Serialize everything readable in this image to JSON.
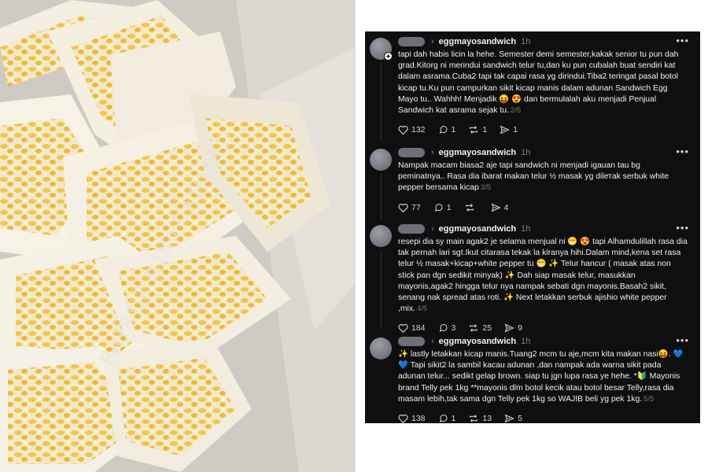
{
  "photo": {
    "watermark": "FAIRUZ BINTI AHMAD"
  },
  "colors": {
    "panel_bg": "#0f0f0f",
    "text": "#f1f1f1",
    "muted": "#7d7d7d",
    "accent_heart": "#4a7bd6"
  },
  "posts": [
    {
      "username": "eggmayosandwich",
      "time": "1h",
      "text": "tapi dah habis licin la hehe. Semester demi semester,kakak senior tu pun dah grad.Kitorg ni merindui sandwich telur tu,dan ku pun cubalah buat sendiri kat dalam asrama.Cuba2 tapi tak capai rasa yg dirindui.Tiba2 teringat pasal botol kicap tu.Ku pun campurkan sikit kicap manis dalam adunan Sandwich Egg Mayo tu.. Wahhh! Menjadik 😝 😍 dan bermulalah aku menjadi Penjual Sandwich kat asrama sejak tu.",
      "page": "2/5",
      "likes": "132",
      "replies": "1",
      "reposts": "1",
      "shares": "1"
    },
    {
      "username": "eggmayosandwich",
      "time": "1h",
      "text": "Nampak macam biasa2 aje tapi sandwich ni menjadi igauan tau bg peminatnya.. Rasa dia ibarat makan telur ½ masak yg dilетak serbuk white pepper bersama kicap",
      "page": "3/5",
      "likes": "77",
      "replies": "1",
      "reposts": "",
      "shares": "4"
    },
    {
      "username": "eggmayosandwich",
      "time": "1h",
      "text": "resepi dia sy main agak2 je selama menjual ni 😁 😍 tapi Alhamdulillah rasa dia tak pernah lari sgt.Ikut citarasa tekak la kiranya hihi.Dalam mind,kena set rasa telur ½ masak+kicap+white pepper tu 😁 ✨ Telur hancur ( masak atas non stick pan dgn sedikit minyak) ✨ Dah siap masak telur, masukkan mayonis,agak2 hingga telur nya nampak sebati dgn mayonis.Basah2 sikit, senang nak spread atas roti. ✨ Next letakkan serbuk ajishio white pepper ,mix.",
      "page": "4/5",
      "likes": "184",
      "replies": "3",
      "reposts": "25",
      "shares": "9"
    },
    {
      "username": "eggmayosandwich",
      "time": "1h",
      "text": "✨ lastly letakkan kicap manis.Tuang2 mcm tu aje,mcm kita makan nasi😝. 💙 💙 Tapi sikit2 la sambil kacau adunan ,dan nampak ada warna sikit pada adunan telur... sedikt gelap brown. siap tu jgn lupa rasa ye hehe. *🔰 Mayonis brand Telly pek 1kg **mayonis dlm botol kecik atau botol besar Telly,rasa dia masam lebih,tak sama dgn Telly pek 1kg so WAJIB beli yg pek 1kg.",
      "page": "5/5",
      "likes": "138",
      "replies": "1",
      "reposts": "13",
      "shares": "5"
    }
  ]
}
